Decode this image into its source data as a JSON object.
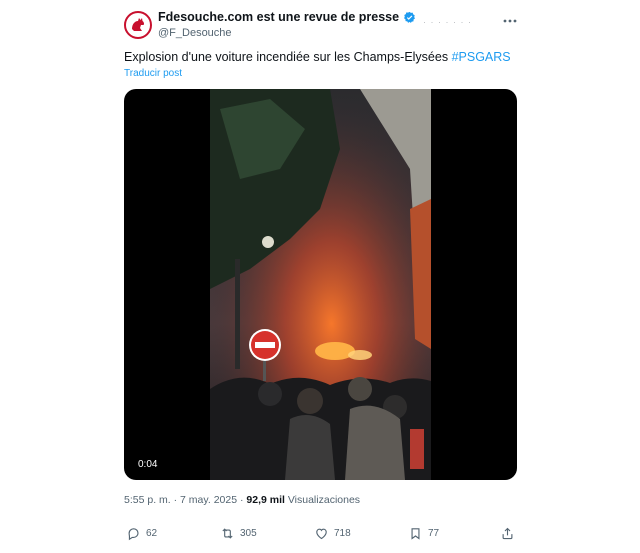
{
  "author": {
    "display_name": "Fdesouche.com est une revue de presse",
    "handle": "@F_Desouche",
    "avatar_icon": "rooster-logo-icon",
    "verified_icon": "verified-badge-icon",
    "header_faint_text": "· · · · · · ·"
  },
  "tweet": {
    "text": "Explosion d'une voiture incendiée sur les Champs-Elysées",
    "hashtag": "#PSGARS",
    "translate_label": "Traducir post"
  },
  "media": {
    "video_time": "0:04"
  },
  "meta": {
    "time": "5:55 p. m.",
    "separator": " · ",
    "date": "7 may. 2025",
    "views_count": "92,9 mil",
    "views_label": "Visualizaciones"
  },
  "actions": {
    "replies": "62",
    "reposts": "305",
    "likes": "718",
    "bookmarks": "77"
  },
  "colors": {
    "accent": "#1d9bf0",
    "text": "#0f1419",
    "muted": "#536471",
    "brand_red": "#c8102e"
  }
}
